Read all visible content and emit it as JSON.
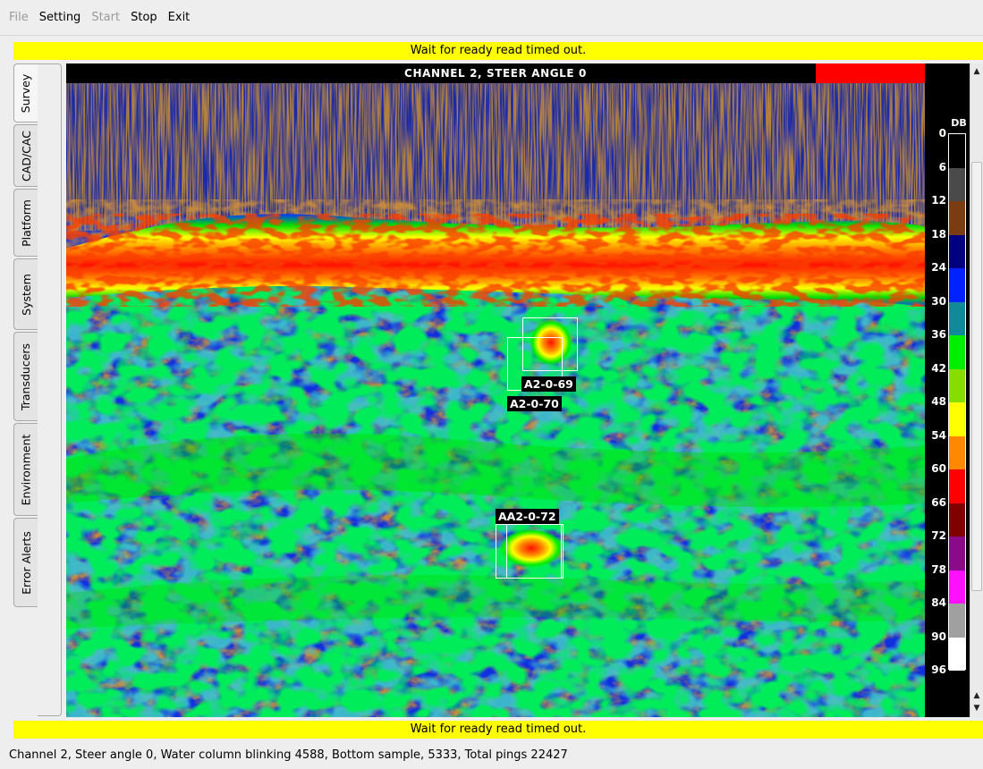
{
  "menu": {
    "file": "File",
    "setting": "Setting",
    "start": "Start",
    "stop": "Stop",
    "exit": "Exit"
  },
  "banner": {
    "top_message": "Wait for ready read timed out.",
    "bottom_message": "Wait for ready read timed out."
  },
  "tabs": [
    {
      "label": "Survey",
      "active": true
    },
    {
      "label": "CAD/CAC",
      "active": false
    },
    {
      "label": "Platform",
      "active": false
    },
    {
      "label": "System",
      "active": false
    },
    {
      "label": "Transducers",
      "active": false
    },
    {
      "label": "Environment",
      "active": false
    },
    {
      "label": "Error Alerts",
      "active": false
    }
  ],
  "sonar": {
    "header": "CHANNEL  2, STEER ANGLE 0",
    "header_indicator_color": "#ff0000",
    "targets": [
      "A2-0-69",
      "A2-0-70",
      "AA2-0-72"
    ]
  },
  "colorbar": {
    "title": "DB",
    "labels": [
      "0",
      "6",
      "12",
      "18",
      "24",
      "30",
      "36",
      "42",
      "48",
      "54",
      "60",
      "66",
      "72",
      "78",
      "84",
      "90",
      "96"
    ],
    "colors": [
      "#000000",
      "#4a4a4a",
      "#7a3c10",
      "#000080",
      "#0022ff",
      "#108a98",
      "#00ee00",
      "#88dd00",
      "#ffff00",
      "#ff8800",
      "#ff0000",
      "#800000",
      "#8a0a8a",
      "#ff10ff",
      "#a0a0a0",
      "#ffffff"
    ]
  },
  "status": {
    "text": "Channel 2, Steer angle 0, Water column blinking 4588, Bottom sample, 5333, Total pings 22427"
  }
}
